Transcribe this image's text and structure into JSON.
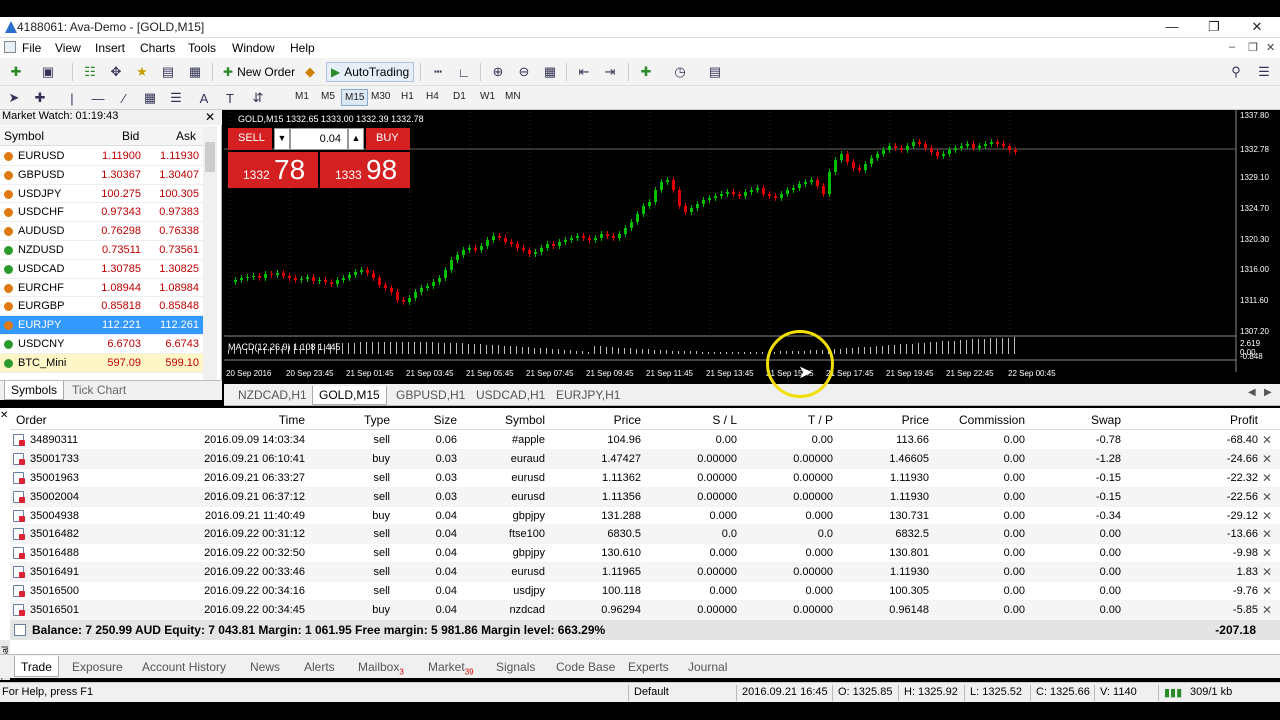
{
  "window": {
    "title": "4188061: Ava-Demo - [GOLD,M15]"
  },
  "menu": [
    "File",
    "View",
    "Insert",
    "Charts",
    "Tools",
    "Window",
    "Help"
  ],
  "toolbar": {
    "new_order": "New Order",
    "auto_trading": "AutoTrading"
  },
  "timeframes": [
    "M1",
    "M5",
    "M15",
    "M30",
    "H1",
    "H4",
    "D1",
    "W1",
    "MN"
  ],
  "active_timeframe": "M15",
  "market_watch": {
    "title": "Market Watch: 01:19:43",
    "headers": {
      "symbol": "Symbol",
      "bid": "Bid",
      "ask": "Ask"
    },
    "rows": [
      {
        "symbol": "EURUSD",
        "bid": "1.11900",
        "ask": "1.11930",
        "dir": "down"
      },
      {
        "symbol": "GBPUSD",
        "bid": "1.30367",
        "ask": "1.30407",
        "dir": "down"
      },
      {
        "symbol": "USDJPY",
        "bid": "100.275",
        "ask": "100.305",
        "dir": "down"
      },
      {
        "symbol": "USDCHF",
        "bid": "0.97343",
        "ask": "0.97383",
        "dir": "down"
      },
      {
        "symbol": "AUDUSD",
        "bid": "0.76298",
        "ask": "0.76338",
        "dir": "down"
      },
      {
        "symbol": "NZDUSD",
        "bid": "0.73511",
        "ask": "0.73561",
        "dir": "up"
      },
      {
        "symbol": "USDCAD",
        "bid": "1.30785",
        "ask": "1.30825",
        "dir": "up"
      },
      {
        "symbol": "EURCHF",
        "bid": "1.08944",
        "ask": "1.08984",
        "dir": "down"
      },
      {
        "symbol": "EURGBP",
        "bid": "0.85818",
        "ask": "0.85848",
        "dir": "down"
      },
      {
        "symbol": "EURJPY",
        "bid": "112.221",
        "ask": "112.261",
        "dir": "down",
        "selected": true
      },
      {
        "symbol": "USDCNY",
        "bid": "6.6703",
        "ask": "6.6743",
        "dir": "up"
      },
      {
        "symbol": "BTC_Mini",
        "bid": "597.09",
        "ask": "599.10",
        "dir": "up",
        "highlight": true
      }
    ],
    "tabs": [
      "Symbols",
      "Tick Chart"
    ]
  },
  "chart": {
    "header": "GOLD,M15  1332.65 1333.00 1332.39 1332.78",
    "sell_label": "SELL",
    "buy_label": "BUY",
    "lot": "0.04",
    "sell_price_small": "1332",
    "sell_price_big": "78",
    "buy_price_small": "1333",
    "buy_price_big": "98",
    "macd_label": "MACD(12,26,9) 1.108 1.445",
    "price_ticks": [
      "1337.80",
      "1332.78",
      "1329.10",
      "1324.70",
      "1320.30",
      "1316.00",
      "1311.60",
      "1307.20"
    ],
    "macd_ticks": [
      "2.619",
      "0.00",
      "-0.848"
    ],
    "time_ticks": [
      "20 Sep 2016",
      "20 Sep 23:45",
      "21 Sep 01:45",
      "21 Sep 03:45",
      "21 Sep 05:45",
      "21 Sep 07:45",
      "21 Sep 09:45",
      "21 Sep 11:45",
      "21 Sep 13:45",
      "21 Sep 15:45",
      "21 Sep 17:45",
      "21 Sep 19:45",
      "21 Sep 22:45",
      "22 Sep 00:45"
    ],
    "tabs": [
      "NZDCAD,H1",
      "GOLD,M15",
      "GBPUSD,H1",
      "USDCAD,H1",
      "EURJPY,H1"
    ],
    "active_tab": "GOLD,M15",
    "colors": {
      "bull": "#00c000",
      "bear": "#e00000",
      "background": "#000000"
    }
  },
  "terminal": {
    "headers": [
      "Order",
      "Time",
      "Type",
      "Size",
      "Symbol",
      "Price",
      "S / L",
      "T / P",
      "Price",
      "Commission",
      "Swap",
      "Profit"
    ],
    "rows": [
      [
        "34890311",
        "2016.09.09 14:03:34",
        "sell",
        "0.06",
        "#apple",
        "104.96",
        "0.00",
        "0.00",
        "113.66",
        "0.00",
        "-0.78",
        "-68.40"
      ],
      [
        "35001733",
        "2016.09.21 06:10:41",
        "buy",
        "0.03",
        "euraud",
        "1.47427",
        "0.00000",
        "0.00000",
        "1.46605",
        "0.00",
        "-1.28",
        "-24.66"
      ],
      [
        "35001963",
        "2016.09.21 06:33:27",
        "sell",
        "0.03",
        "eurusd",
        "1.11362",
        "0.00000",
        "0.00000",
        "1.11930",
        "0.00",
        "-0.15",
        "-22.32"
      ],
      [
        "35002004",
        "2016.09.21 06:37:12",
        "sell",
        "0.03",
        "eurusd",
        "1.11356",
        "0.00000",
        "0.00000",
        "1.11930",
        "0.00",
        "-0.15",
        "-22.56"
      ],
      [
        "35004938",
        "2016.09.21 11:40:49",
        "buy",
        "0.04",
        "gbpjpy",
        "131.288",
        "0.000",
        "0.000",
        "130.731",
        "0.00",
        "-0.34",
        "-29.12"
      ],
      [
        "35016482",
        "2016.09.22 00:31:12",
        "sell",
        "0.04",
        "ftse100",
        "6830.5",
        "0.0",
        "0.0",
        "6832.5",
        "0.00",
        "0.00",
        "-13.66"
      ],
      [
        "35016488",
        "2016.09.22 00:32:50",
        "sell",
        "0.04",
        "gbpjpy",
        "130.610",
        "0.000",
        "0.000",
        "130.801",
        "0.00",
        "0.00",
        "-9.98"
      ],
      [
        "35016491",
        "2016.09.22 00:33:46",
        "sell",
        "0.04",
        "eurusd",
        "1.11965",
        "0.00000",
        "0.00000",
        "1.11930",
        "0.00",
        "0.00",
        "1.83"
      ],
      [
        "35016500",
        "2016.09.22 00:34:16",
        "sell",
        "0.04",
        "usdjpy",
        "100.118",
        "0.000",
        "0.000",
        "100.305",
        "0.00",
        "0.00",
        "-9.76"
      ],
      [
        "35016501",
        "2016.09.22 00:34:45",
        "buy",
        "0.04",
        "nzdcad",
        "0.96294",
        "0.00000",
        "0.00000",
        "0.96148",
        "0.00",
        "0.00",
        "-5.85"
      ]
    ],
    "balance_line": "Balance: 7 250.99 AUD  Equity: 7 043.81  Margin: 1 061.95  Free margin: 5 981.86  Margin level: 663.29%",
    "total_profit": "-207.18",
    "side_label": "Terminal",
    "tabs": [
      {
        "label": "Trade",
        "badge": ""
      },
      {
        "label": "Exposure",
        "badge": ""
      },
      {
        "label": "Account History",
        "badge": ""
      },
      {
        "label": "News",
        "badge": ""
      },
      {
        "label": "Alerts",
        "badge": ""
      },
      {
        "label": "Mailbox",
        "badge": "3"
      },
      {
        "label": "Market",
        "badge": "39"
      },
      {
        "label": "Signals",
        "badge": ""
      },
      {
        "label": "Code Base",
        "badge": ""
      },
      {
        "label": "Experts",
        "badge": ""
      },
      {
        "label": "Journal",
        "badge": ""
      }
    ]
  },
  "status": {
    "help": "For Help, press F1",
    "profile": "Default",
    "datetime": "2016.09.21 16:45",
    "open": "O: 1325.85",
    "high": "H: 1325.92",
    "low": "L: 1325.52",
    "close": "C: 1325.66",
    "volume": "V: 1140",
    "traffic": "309/1 kb"
  }
}
